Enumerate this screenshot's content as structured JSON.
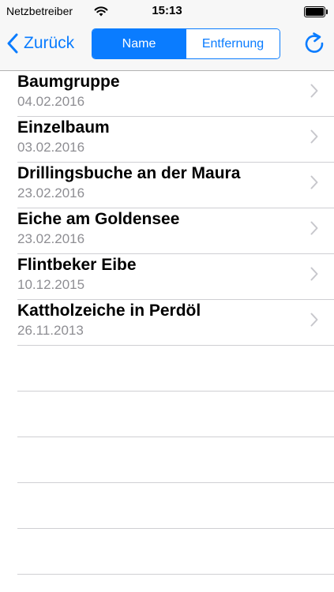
{
  "status_bar": {
    "carrier": "Netzbetreiber",
    "time": "15:13",
    "battery_level": 1.0
  },
  "nav": {
    "back_label": "Zurück",
    "segments": [
      {
        "label": "Name",
        "selected": true
      },
      {
        "label": "Entfernung",
        "selected": false
      }
    ],
    "refresh_icon": "refresh-icon"
  },
  "list": {
    "items": [
      {
        "title": "Baumgruppe",
        "date": "04.02.2016"
      },
      {
        "title": "Einzelbaum",
        "date": "03.02.2016"
      },
      {
        "title": "Drillingsbuche an der Maura",
        "date": "23.02.2016"
      },
      {
        "title": "Eiche am Goldensee",
        "date": "23.02.2016"
      },
      {
        "title": "Flintbeker Eibe",
        "date": "10.12.2015"
      },
      {
        "title": "Kattholzeiche in Perdöl",
        "date": "26.11.2013"
      }
    ]
  },
  "colors": {
    "accent": "#0a7cff",
    "secondary_text": "#8e8e93",
    "separator": "#cfcfd3",
    "bar_background": "#f7f7f7"
  }
}
